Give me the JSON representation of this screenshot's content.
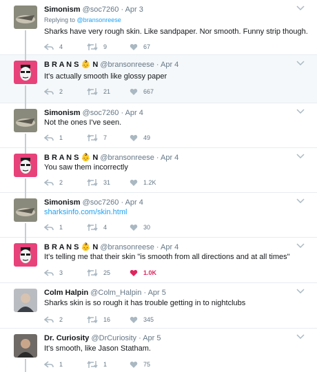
{
  "tweets": [
    {
      "name": "Simonism",
      "handle": "@soc7260",
      "time": "Apr 3",
      "reply_prefix": "Replying to",
      "reply_to": "@bransonreese",
      "text": "Sharks have very rough skin. Like sandpaper. Nor smooth. Funny strip though.",
      "replies": "4",
      "retweets": "9",
      "likes": "67",
      "avatar": "shark-photo-avatar"
    },
    {
      "name": "B R A N S",
      "name_suffix": "N",
      "handle": "@bransonreese",
      "time": "Apr 4",
      "text": "It's actually smooth like glossy paper",
      "replies": "2",
      "retweets": "21",
      "likes": "667",
      "avatar": "cartoon-face-avatar"
    },
    {
      "name": "Simonism",
      "handle": "@soc7260",
      "time": "Apr 4",
      "text": "Not the ones I've  seen.",
      "replies": "1",
      "retweets": "7",
      "likes": "49",
      "avatar": "shark-photo-avatar"
    },
    {
      "name": "B R A N S",
      "name_suffix": "N",
      "handle": "@bransonreese",
      "time": "Apr 4",
      "text": "You saw them incorrectly",
      "replies": "2",
      "retweets": "31",
      "likes": "1.2K",
      "avatar": "cartoon-face-avatar"
    },
    {
      "name": "Simonism",
      "handle": "@soc7260",
      "time": "Apr 4",
      "text": "sharksinfo.com/skin.html",
      "replies": "1",
      "retweets": "4",
      "likes": "30",
      "avatar": "shark-photo-avatar"
    },
    {
      "name": "B R A N S",
      "name_suffix": "N",
      "handle": "@bransonreese",
      "time": "Apr 4",
      "text": "It's telling me that their skin \"is smooth from all directions and at all times\"",
      "replies": "3",
      "retweets": "25",
      "likes": "1.0K",
      "liked": true,
      "avatar": "cartoon-face-avatar"
    },
    {
      "name": "Colm Halpin",
      "handle": "@Colm_Halpin",
      "time": "Apr 5",
      "text": "Sharks skin is so rough it has trouble getting in to nightclubs",
      "replies": "2",
      "retweets": "16",
      "likes": "345",
      "avatar": "man-photo-avatar"
    },
    {
      "name": "Dr. Curiosity",
      "handle": "@DrCuriosity",
      "time": "Apr 5",
      "text": "It's smooth, like Jason Statham.",
      "replies": "1",
      "retweets": "1",
      "likes": "75",
      "avatar": "man-photo-avatar"
    }
  ],
  "colors": {
    "accent": "#1da1f2",
    "like": "#e0245e",
    "meta": "#657786",
    "avatar_pink": "#e8427a"
  }
}
